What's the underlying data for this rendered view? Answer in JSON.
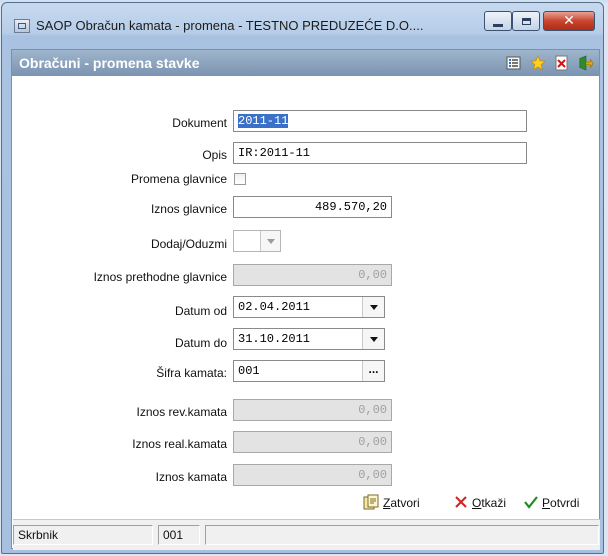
{
  "window": {
    "title": "SAOP Obračun kamata - promena - TESTNO PREDUZEĆE D.O....",
    "minimize_glyph": "",
    "close_glyph": "✕"
  },
  "panel": {
    "title": "Obračuni - promena stavke"
  },
  "form": {
    "dokument": {
      "label": "Dokument",
      "value": "2011-11"
    },
    "opis": {
      "label": "Opis",
      "value": "IR:2011-11"
    },
    "promena_glavnice": {
      "label": "Promena glavnice",
      "checked": false
    },
    "iznos_glavnice": {
      "label": "Iznos glavnice",
      "value": "489.570,20"
    },
    "dodaj_oduzmi": {
      "label": "Dodaj/Oduzmi",
      "value": ""
    },
    "iznos_prethodne_glavnice": {
      "label": "Iznos prethodne glavnice",
      "value": "0,00"
    },
    "datum_od": {
      "label": "Datum od",
      "value": "02.04.2011"
    },
    "datum_do": {
      "label": "Datum do",
      "value": "31.10.2011"
    },
    "sifra_kamata": {
      "label": "Šifra kamata:",
      "value": "001",
      "lookup_glyph": "..."
    },
    "iznos_rev_kamata": {
      "label": "Iznos rev.kamata",
      "value": "0,00"
    },
    "iznos_real_kamata": {
      "label": "Iznos real.kamata",
      "value": "0,00"
    },
    "iznos_kamata": {
      "label": "Iznos kamata",
      "value": "0,00"
    }
  },
  "buttons": {
    "zatvori": {
      "hotkey": "Z",
      "rest": "atvori"
    },
    "otkazi": {
      "hotkey": "O",
      "rest": "tkaži"
    },
    "potvrdi": {
      "hotkey": "P",
      "rest": "otvrdi"
    }
  },
  "status": {
    "cell1": "Skrbnik",
    "cell2": "001",
    "cell3": ""
  },
  "colors": {
    "header_bar": "#8aa2bd",
    "selection": "#3a70c8",
    "close_button": "#c7452f"
  },
  "icons": [
    "app-icon",
    "list-icon",
    "star-icon",
    "delete-icon",
    "exit-icon",
    "close-window-icon",
    "cancel-x-icon",
    "confirm-check-icon"
  ]
}
